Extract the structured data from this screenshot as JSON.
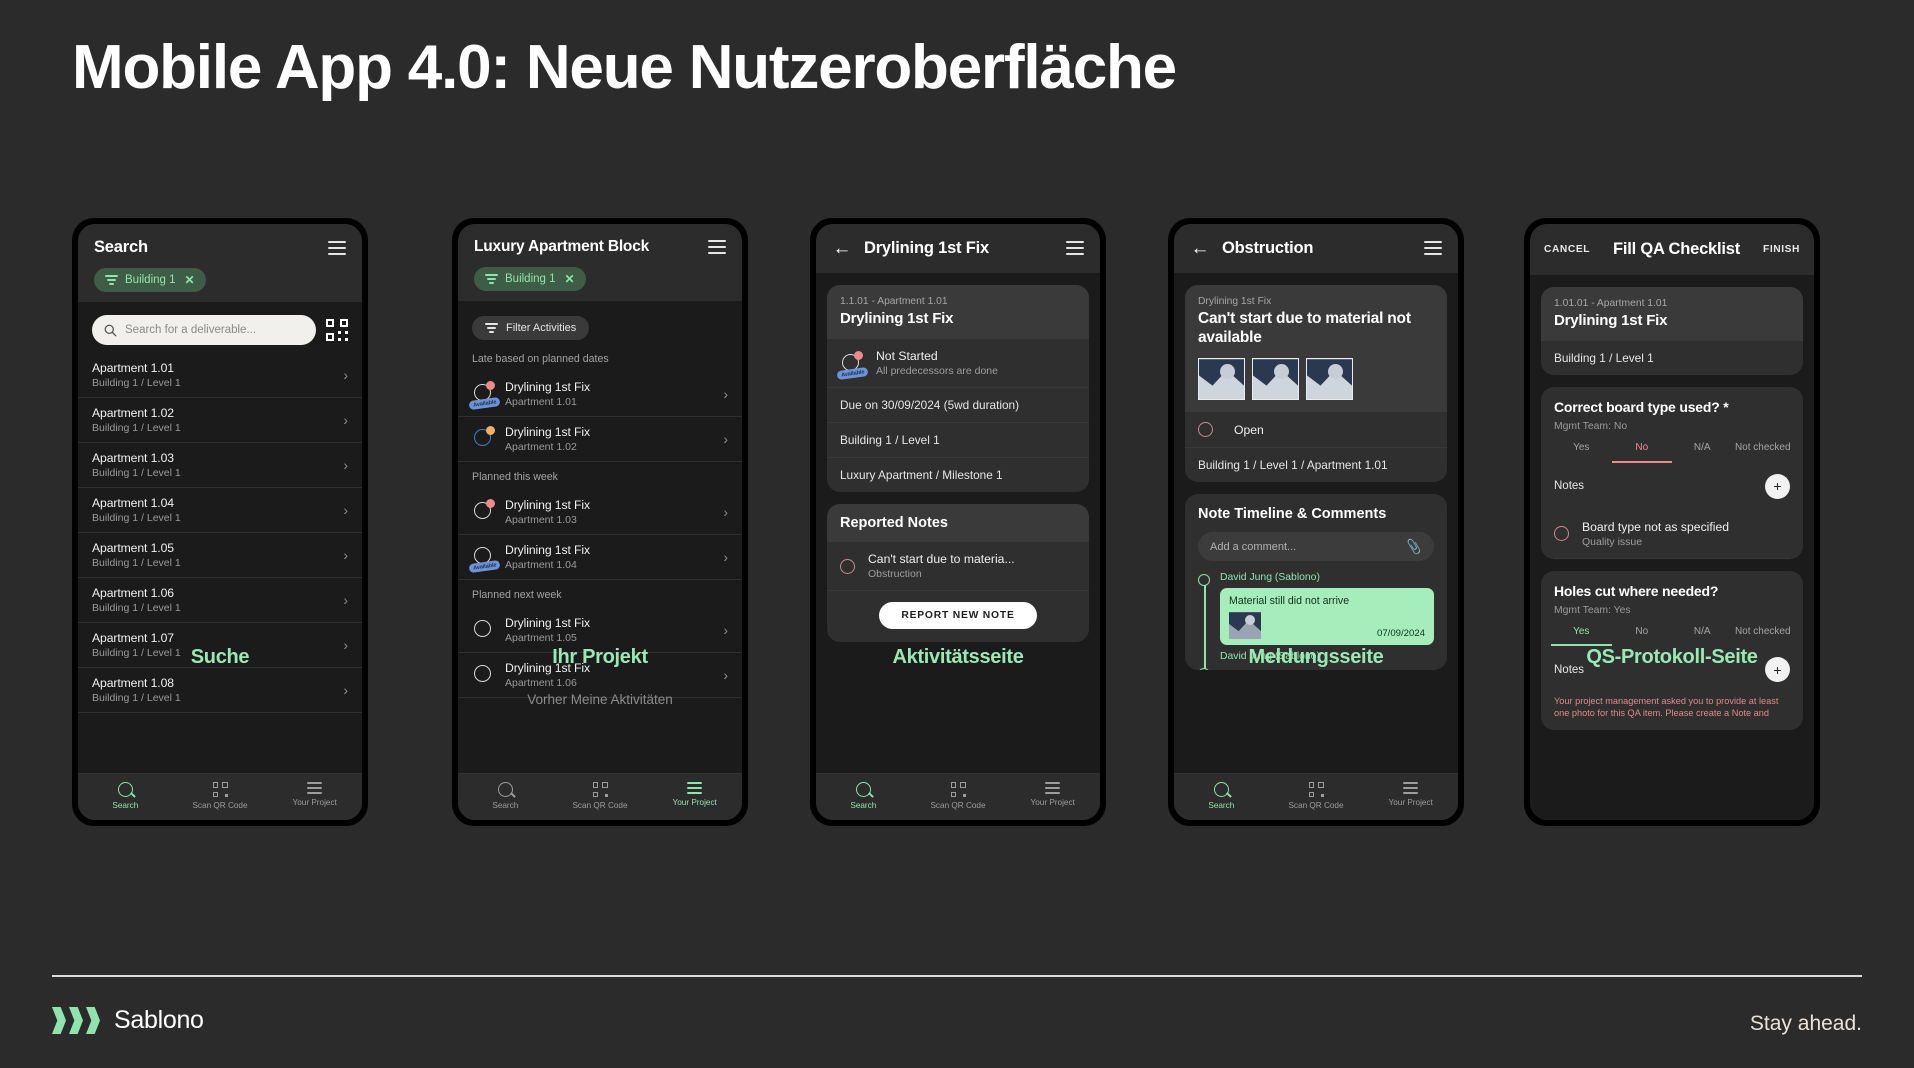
{
  "slide": {
    "title": "Mobile App 4.0: Neue Nutzeroberfläche",
    "footer_logo_text": "Sablono",
    "footer_tagline": "Stay ahead."
  },
  "captions": [
    {
      "label": "Suche",
      "sub": ""
    },
    {
      "label": "Ihr Projekt",
      "sub": "Vorher Meine Aktivitäten"
    },
    {
      "label": "Aktivitätsseite",
      "sub": ""
    },
    {
      "label": "Meldungsseite",
      "sub": ""
    },
    {
      "label": "QS-Protokoll-Seite",
      "sub": ""
    }
  ],
  "bottom_nav": {
    "search": "Search",
    "scan": "Scan QR Code",
    "project": "Your Project"
  },
  "screen_search": {
    "title": "Search",
    "chip": "Building 1",
    "chip_close": "✕",
    "search_placeholder": "Search for a deliverable...",
    "items": [
      {
        "name": "Apartment 1.01",
        "sub": "Building 1 / Level 1"
      },
      {
        "name": "Apartment 1.02",
        "sub": "Building 1 / Level 1"
      },
      {
        "name": "Apartment 1.03",
        "sub": "Building 1 / Level 1"
      },
      {
        "name": "Apartment 1.04",
        "sub": "Building 1 / Level 1"
      },
      {
        "name": "Apartment 1.05",
        "sub": "Building 1 / Level 1"
      },
      {
        "name": "Apartment 1.06",
        "sub": "Building 1 / Level 1"
      },
      {
        "name": "Apartment 1.07",
        "sub": "Building 1 / Level 1"
      },
      {
        "name": "Apartment 1.08",
        "sub": "Building 1 / Level 1"
      }
    ]
  },
  "screen_project": {
    "title": "Luxury Apartment Block",
    "chip": "Building 1",
    "chip_close": "✕",
    "filter_button": "Filter Activities",
    "groups": [
      {
        "header": "Late based on planned dates",
        "rows": [
          {
            "name": "Drylining 1st Fix",
            "sub": "Apartment 1.01",
            "badge": "Available",
            "dot": "red",
            "ring": "white"
          },
          {
            "name": "Drylining 1st Fix",
            "sub": "Apartment 1.02",
            "badge": "",
            "dot": "orange",
            "ring": "blue"
          }
        ]
      },
      {
        "header": "Planned this week",
        "rows": [
          {
            "name": "Drylining 1st Fix",
            "sub": "Apartment 1.03",
            "badge": "",
            "dot": "red",
            "ring": "white"
          },
          {
            "name": "Drylining 1st Fix",
            "sub": "Apartment 1.04",
            "badge": "Available",
            "dot": "none",
            "ring": "white"
          }
        ]
      },
      {
        "header": "Planned next week",
        "rows": [
          {
            "name": "Drylining 1st Fix",
            "sub": "Apartment 1.05",
            "badge": "",
            "dot": "none",
            "ring": "white"
          },
          {
            "name": "Drylining 1st Fix",
            "sub": "Apartment 1.06",
            "badge": "",
            "dot": "none",
            "ring": "white"
          }
        ]
      }
    ]
  },
  "screen_activity": {
    "title": "Drylining 1st Fix",
    "card_sub": "1.1.01 - Apartment 1.01",
    "card_title": "Drylining 1st Fix",
    "status_title": "Not Started",
    "status_sub": "All predecessors are done",
    "status_badge": "Available",
    "row_due": "Due on 30/09/2024 (5wd duration)",
    "row_location": "Building 1 / Level 1",
    "row_milestone": "Luxury Apartment / Milestone 1",
    "notes_header": "Reported Notes",
    "note_title": "Can't start due to materia...",
    "note_sub": "Obstruction",
    "report_button": "REPORT NEW NOTE"
  },
  "screen_note": {
    "title": "Obstruction",
    "card_sub": "Drylining 1st Fix",
    "card_title": "Can't start due to material not available",
    "status": "Open",
    "location": "Building 1 / Level 1 / Apartment 1.01",
    "timeline_header": "Note Timeline & Comments",
    "comment_placeholder": "Add a comment...",
    "entries": [
      {
        "author": "David Jung (Sablono)",
        "message": "Material still did not arrive",
        "date": "07/09/2024"
      },
      {
        "author": "David Jung (Sablono)",
        "message": "",
        "date": ""
      }
    ]
  },
  "screen_qa": {
    "cancel": "CANCEL",
    "title": "Fill QA Checklist",
    "finish": "FINISH",
    "card_sub": "1.01.01 - Apartment 1.01",
    "card_title": "Drylining 1st Fix",
    "card_location": "Building 1 / Level 1",
    "questions": [
      {
        "text": "Correct board type used? *",
        "mgmt": "Mgmt Team: No",
        "options": [
          "Yes",
          "No",
          "N/A",
          "Not checked"
        ],
        "selected": "No",
        "notes_label": "Notes",
        "note_title": "Board type not as specified",
        "note_sub": "Quality issue",
        "warning": ""
      },
      {
        "text": "Holes cut where needed?",
        "mgmt": "Mgmt Team: Yes",
        "options": [
          "Yes",
          "No",
          "N/A",
          "Not checked"
        ],
        "selected": "Yes",
        "notes_label": "Notes",
        "note_title": "",
        "note_sub": "",
        "warning": "Your project management asked you to provide at least one photo for this QA item. Please create a Note and"
      }
    ]
  }
}
